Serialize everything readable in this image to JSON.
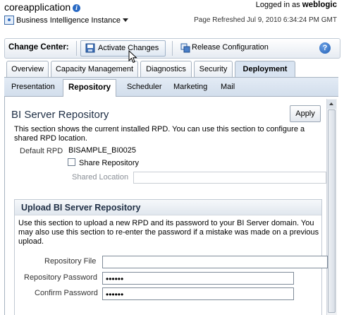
{
  "header": {
    "app_title": "coreapplication",
    "logged_in_label": "Logged in as",
    "username": "weblogic",
    "instance_menu": "Business Intelligence Instance",
    "page_refreshed": "Page Refreshed Jul 9, 2010 6:34:24 PM GMT"
  },
  "change_center": {
    "label": "Change Center:",
    "activate_label": "Activate Changes",
    "release_label": "Release Configuration",
    "help_glyph": "?"
  },
  "tabs": [
    {
      "label": "Overview"
    },
    {
      "label": "Capacity Management"
    },
    {
      "label": "Diagnostics"
    },
    {
      "label": "Security"
    },
    {
      "label": "Deployment"
    }
  ],
  "subtabs": [
    {
      "label": "Presentation"
    },
    {
      "label": "Repository"
    },
    {
      "label": "Scheduler"
    },
    {
      "label": "Marketing"
    },
    {
      "label": "Mail"
    }
  ],
  "active_tab": "Deployment",
  "active_subtab": "Repository",
  "repository": {
    "title": "BI Server Repository",
    "apply_label": "Apply",
    "description": "This section shows the current installed RPD. You can use this section to configure a shared RPD location.",
    "default_rpd_label": "Default RPD",
    "default_rpd_value": "BISAMPLE_BI0025",
    "share_label": "Share Repository",
    "share_checked": false,
    "shared_location_label": "Shared Location",
    "shared_location_value": ""
  },
  "upload": {
    "title": "Upload BI Server Repository",
    "description": "Use this section to upload a new RPD and its password to your BI Server domain. You may also use this section to re-enter the password if a mistake was made on a previous upload.",
    "file_label": "Repository File",
    "file_value": "",
    "password_label": "Repository Password",
    "password_value": "••••••",
    "confirm_label": "Confirm Password",
    "confirm_value": "••••••"
  },
  "colors": {
    "accent": "#2a6ac4",
    "tab_active_bg": "#d9e4f1",
    "heading": "#1f2f45"
  },
  "icons": {
    "title_info": "info-icon",
    "instance": "instance-icon",
    "activate": "lock-icon",
    "release": "release-icon",
    "help": "help-icon"
  }
}
